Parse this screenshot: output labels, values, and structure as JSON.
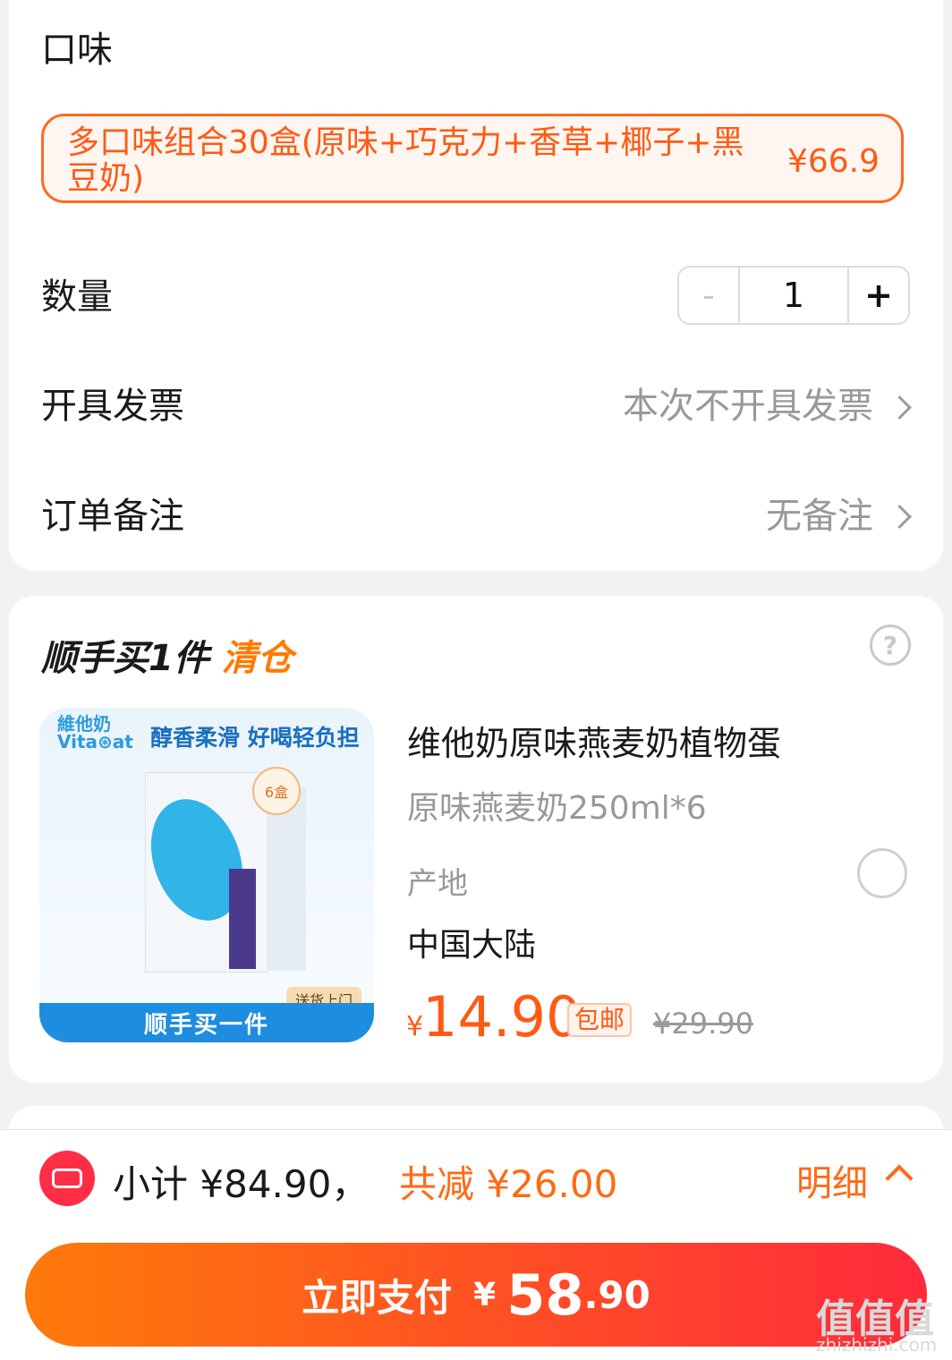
{
  "flavor": {
    "label": "口味",
    "option_text": "多口味组合30盒(原味+巧克力+香草+椰子+黑豆奶)",
    "option_price": "¥66.9"
  },
  "quantity": {
    "label": "数量",
    "minus": "-",
    "value": "1",
    "plus": "+"
  },
  "invoice": {
    "label": "开具发票",
    "value": "本次不开具发票"
  },
  "note": {
    "label": "订单备注",
    "value": "无备注"
  },
  "addon": {
    "title_main": "顺手买1件",
    "title_accent": "清仓",
    "help_icon": "?",
    "image": {
      "brand": "維他奶",
      "brand_en": "Vita⊛at",
      "slogan": "醇香柔滑 好喝轻负担",
      "badge": "6盒",
      "delivery_tag": "送货上门",
      "banner": "顺手买一件"
    },
    "product_title": "维他奶原味燕麦奶植物蛋",
    "spec": "原味燕麦奶250ml*6",
    "origin_label": "产地",
    "origin_value": "中国大陆",
    "price_symbol": "¥",
    "price": "14.90",
    "free_shipping": "包邮",
    "original_price": "¥29.90"
  },
  "summary": {
    "subtotal": "小计 ¥84.90，",
    "discount": "共减 ¥26.00",
    "detail": "明细"
  },
  "pay": {
    "label": "立即支付",
    "currency": "¥",
    "amount_int": "58",
    "amount_dec": ".90"
  },
  "watermark": {
    "text": "值值值",
    "sub": "zhizhizhi.com"
  },
  "colors": {
    "accent": "#ff5a14",
    "pay_start": "#ff7a0a",
    "pay_end": "#ff2a3c"
  }
}
